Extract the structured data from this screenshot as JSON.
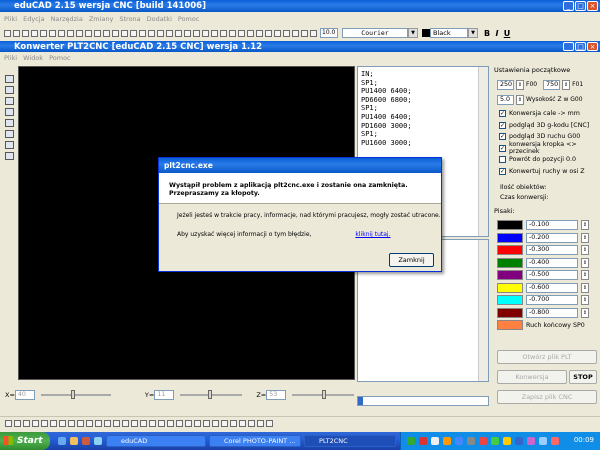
{
  "main_window": {
    "title": "eduCAD 2.15 wersja CNC [build 141006]",
    "menu": [
      "Pliki",
      "Edycja",
      "Narzędzia",
      "Zmiany",
      "Strona",
      "Dodatki",
      "Pomoc"
    ],
    "zoom": "10.0",
    "font": "Courier",
    "color": "Black",
    "bold": "B",
    "italic": "I",
    "underline": "U"
  },
  "child_window": {
    "title": "Konwerter PLT2CNC [eduCAD 2.15 CNC] wersja 1.12",
    "menu": [
      "Pliki",
      "Widok",
      "Pomoc"
    ]
  },
  "code": {
    "lines": [
      "IN;",
      "SP1;",
      "PU1400 6400;",
      "PD6600 6800;",
      "SP1;",
      "PU1400 6400;",
      "PD1600 3000;",
      "SP1;",
      "PU1600 3000;"
    ]
  },
  "settings": {
    "title": "Ustawienia początkowe",
    "x_value": "250",
    "x_label": "F00",
    "y_value": "750",
    "y_label": "F01",
    "z_value": "5.0",
    "z_label": "Wysokość Z w G00",
    "options": [
      {
        "label": "Konwersja cale -> mm",
        "checked": true
      },
      {
        "label": "podgląd 3D g-kodu [CNC]",
        "checked": true
      },
      {
        "label": "podgląd 3D ruchu G00",
        "checked": true
      },
      {
        "label": "konwersja kropka <> przecinek",
        "checked": true
      },
      {
        "label": "Powrót do pozycji 0.0",
        "checked": false
      },
      {
        "label": "Konwertuj ruchy w osi Z",
        "checked": true
      }
    ],
    "count_label": "Ilość obiektów:",
    "time_label": "Czas konwersji:"
  },
  "pens": {
    "title": "Pisaki:",
    "rows": [
      {
        "color": "#000000",
        "value": "-0.100"
      },
      {
        "color": "#0000FF",
        "value": "-0.200"
      },
      {
        "color": "#FF0000",
        "value": "-0.300"
      },
      {
        "color": "#008000",
        "value": "-0.400"
      },
      {
        "color": "#800080",
        "value": "-0.500"
      },
      {
        "color": "#FFFF00",
        "value": "-0.600"
      },
      {
        "color": "#00FFFF",
        "value": "-0.700"
      },
      {
        "color": "#800000",
        "value": "-0.800"
      }
    ],
    "end_color": "#FF8040",
    "end_label": "Ruch końcowy SP0"
  },
  "buttons": {
    "open_plt": "Otwórz plik PLT",
    "convert": "Konwersja",
    "stop": "STOP",
    "save_cnc": "Zapisz plik CNC"
  },
  "coords": {
    "x_label": "X=",
    "x_value": "40",
    "y_label": "Y=",
    "y_value": "11",
    "z_label": "Z=",
    "z_value": "53"
  },
  "dialog": {
    "title": "plt2cnc.exe",
    "heading": "Wystąpił problem z aplikacją plt2cnc.exe i zostanie ona zamknięta. Przepraszamy za kłopoty.",
    "info": "Jeżeli jesteś w trakcie pracy, informacje, nad którymi pracujesz, mogły zostać utracone.",
    "more": "Aby uzyskać więcej informacji o tym błędzie,",
    "link": "kliknij tutaj.",
    "close": "Zamknij"
  },
  "taskbar": {
    "start": "Start",
    "tasks": [
      "eduCAD",
      "Corel PHOTO-PAINT ...",
      "PLT2CNC"
    ],
    "clock": "00:09"
  }
}
